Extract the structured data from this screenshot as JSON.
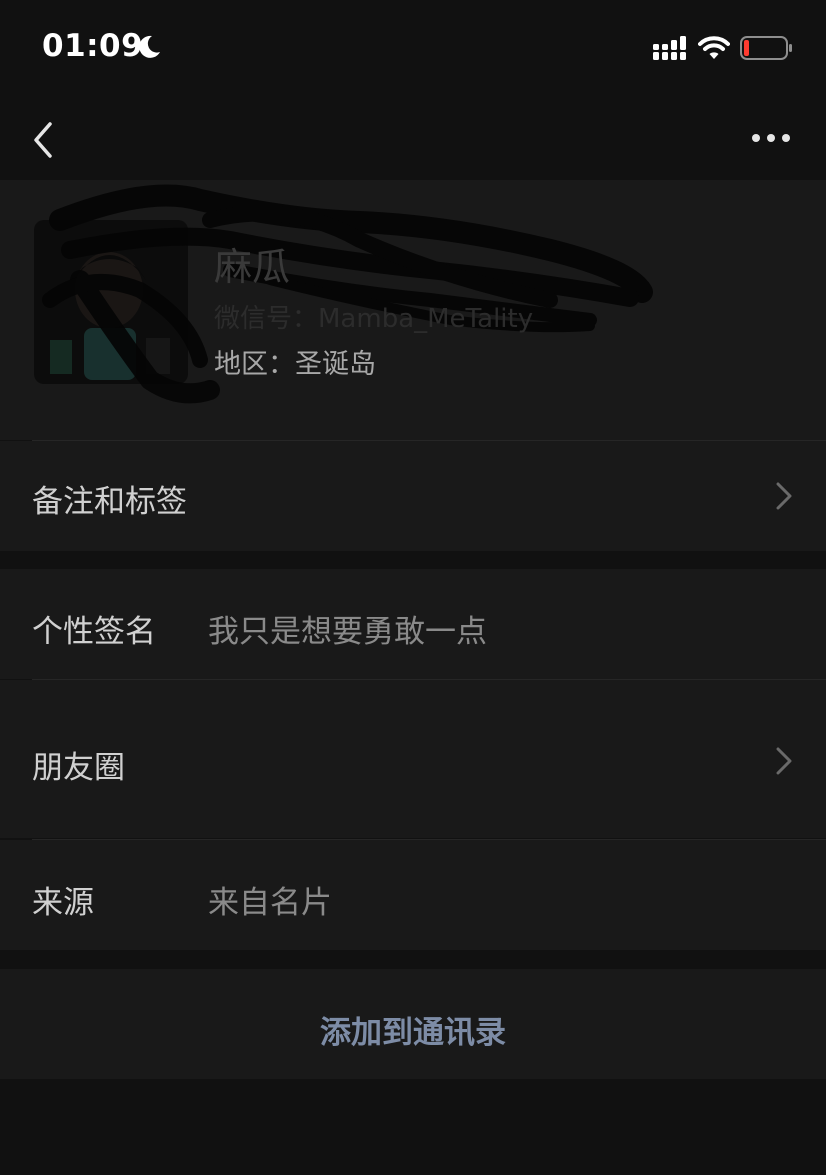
{
  "status_bar": {
    "time": "01:09",
    "icons": [
      "moon-icon",
      "signal-icon",
      "wifi-icon",
      "battery-icon"
    ],
    "battery_color": "#ff3b30"
  },
  "nav": {
    "back_icon": "chevron-left-icon",
    "more_icon": "more-dots-icon"
  },
  "profile": {
    "name": "麻瓜",
    "wechat_id": "微信号：Mamba_MeTality",
    "region": "地区：圣诞岛"
  },
  "rows": {
    "remark": {
      "label": "备注和标签"
    },
    "signature": {
      "label": "个性签名",
      "value": "我只是想要勇敢一点"
    },
    "moments": {
      "label": "朋友圈"
    },
    "source": {
      "label": "来源",
      "value": "来自名片"
    }
  },
  "actions": {
    "add_to_contacts": "添加到通讯录"
  },
  "colors": {
    "background": "#111111",
    "cell": "#191919",
    "link": "#7d8ca6"
  }
}
